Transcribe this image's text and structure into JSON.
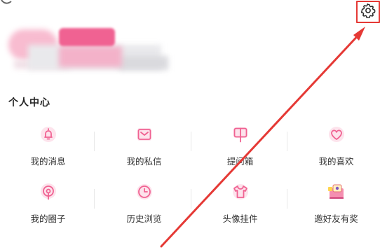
{
  "header": {
    "settings_icon": "gear-icon",
    "highlight_color": "#e53935"
  },
  "section": {
    "title": "个人中心"
  },
  "grid": {
    "items": [
      {
        "label": "我的消息",
        "icon": "bell-icon"
      },
      {
        "label": "我的私信",
        "icon": "envelope-icon"
      },
      {
        "label": "提问箱",
        "icon": "mailbox-icon"
      },
      {
        "label": "我的喜欢",
        "icon": "heart-icon"
      },
      {
        "label": "我的圈子",
        "icon": "circle-icon"
      },
      {
        "label": "历史浏览",
        "icon": "clock-icon"
      },
      {
        "label": "头像挂件",
        "icon": "shirt-icon"
      },
      {
        "label": "邀好友有奖",
        "icon": "gift-icon"
      }
    ]
  },
  "colors": {
    "accent": "#f06292",
    "annotation": "#e53935"
  }
}
